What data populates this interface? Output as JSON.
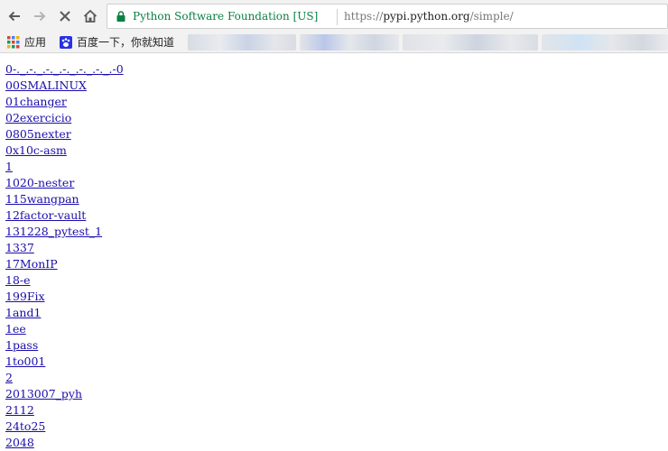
{
  "browser": {
    "site_identity": "Python Software Foundation [US]",
    "url_scheme": "https://",
    "url_host": "pypi.python.org",
    "url_path": "/simple/",
    "back_icon": "back-arrow-icon",
    "forward_icon": "forward-arrow-icon",
    "stop_icon": "stop-x-icon",
    "home_icon": "home-icon",
    "lock_color": "#0b8043"
  },
  "bookmarks": {
    "apps_label": "应用",
    "baidu_label": "百度一下，你就知道"
  },
  "packages": [
    "0-._.-._.-._.-._.-._.-._.-0",
    "00SMALINUX",
    "01changer",
    "02exercicio",
    "0805nexter",
    "0x10c-asm",
    "1",
    "1020-nester",
    "115wangpan",
    "12factor-vault",
    "131228_pytest_1",
    "1337",
    "17MonIP",
    "18-e",
    "199Fix",
    "1and1",
    "1ee",
    "1pass",
    "1to001",
    "2",
    "2013007_pyh",
    "2112",
    "24to25",
    "2048"
  ],
  "colors": {
    "link": "#1a0dab",
    "toolbar_bg": "#f2f2f2"
  }
}
